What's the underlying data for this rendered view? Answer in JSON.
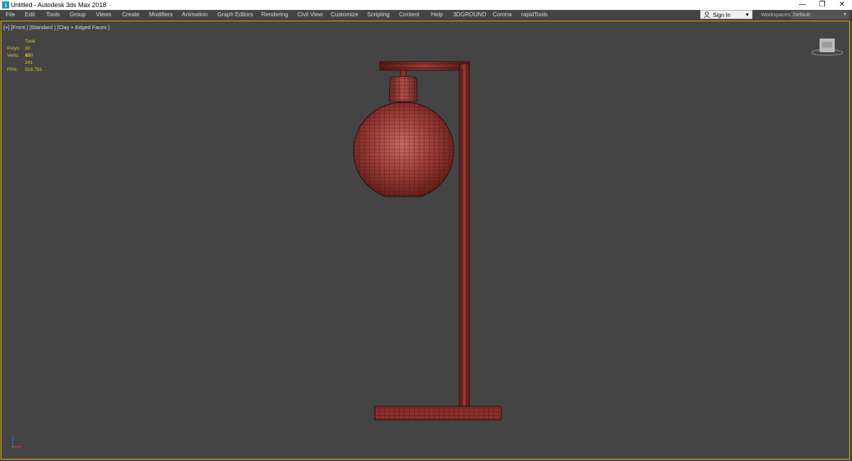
{
  "window": {
    "title": "Untitled - Autodesk 3ds Max 2018",
    "minimize_glyph": "—",
    "restore_glyph": "❐",
    "close_glyph": "✕"
  },
  "menu": {
    "items": [
      "File",
      "Edit",
      "Tools",
      "Group",
      "Views",
      "Create",
      "Modifiers",
      "Animation",
      "Graph Editors",
      "Rendering",
      "Civil View",
      "Customize",
      "Scripting",
      "Content",
      "Help",
      "3DGROUND",
      "Corona",
      "rapidTools"
    ]
  },
  "account": {
    "sign_in_label": "Sign In",
    "workspaces_label": "Workspaces:",
    "workspace_value": "Default"
  },
  "viewport": {
    "label": "[+] [Front ] [Standard ] [Clay + Edged Faces ]",
    "stats": {
      "header": "Total",
      "polys_label": "Polys:",
      "polys_value": "30 400",
      "verts_label": "Verts:",
      "verts_value": "15 241",
      "fps_label": "FPS:",
      "fps_value": "519,751"
    }
  },
  "colors": {
    "mesh": "#8a2f2c",
    "wire": "#2a0b0a",
    "viewport_border": "#e6b800",
    "stats_text": "#e6c72a"
  }
}
